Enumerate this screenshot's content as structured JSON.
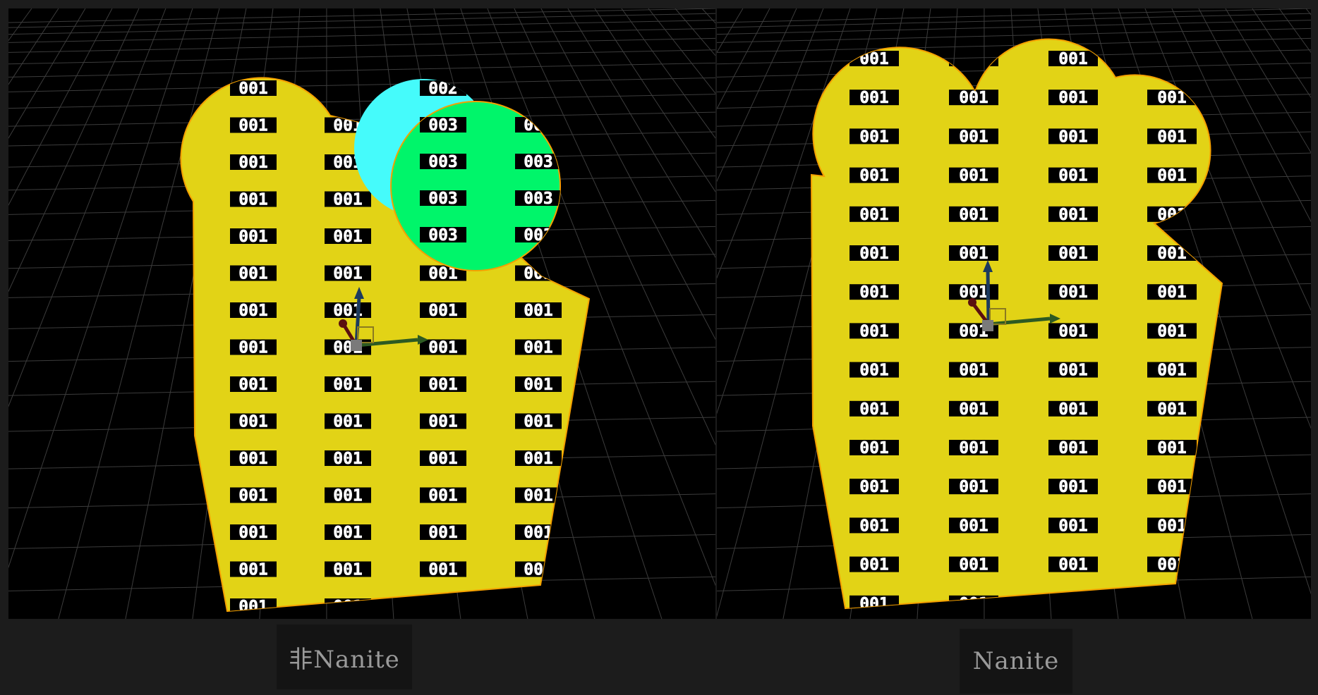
{
  "left_view": {
    "caption": "非Nanite",
    "tile_labels": {
      "primary": "001",
      "secondary": "002",
      "tertiary": "003"
    }
  },
  "right_view": {
    "caption": "Nanite",
    "tile_labels": {
      "primary": "001"
    }
  },
  "colors": {
    "mesh_primary": "#e2d316",
    "mesh_outline": "#f5a000",
    "mesh_secondary": "#45fbfb",
    "mesh_tertiary": "#00f56a",
    "label_box": "#000000",
    "grid_line": "#3c3c3c",
    "gizmo_z": "#1c3a5e",
    "gizmo_y": "#2d5a22",
    "gizmo_x": "#5a0f0f"
  },
  "icons": {
    "transform_gizmo": "transform-gizmo-icon"
  }
}
